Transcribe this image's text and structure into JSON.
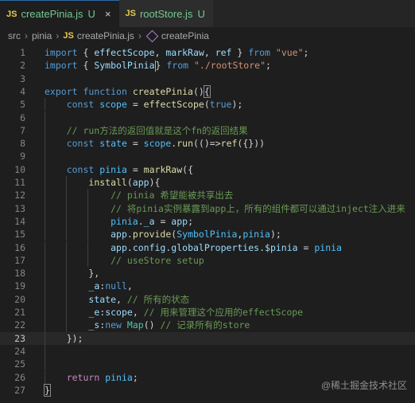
{
  "tabs": [
    {
      "icon": "JS",
      "label": "createPinia.js",
      "status": "U",
      "close": "×"
    },
    {
      "icon": "JS",
      "label": "rootStore.js",
      "status": "U"
    }
  ],
  "breadcrumb": {
    "items": [
      "src",
      "pinia"
    ],
    "file": "createPinia.js",
    "symbol": "createPinia",
    "sep": "›"
  },
  "lines": [
    {
      "n": "1",
      "tokens": [
        [
          "kw",
          "import"
        ],
        [
          "op",
          " { "
        ],
        [
          "var",
          "effectScope"
        ],
        [
          "op",
          ", "
        ],
        [
          "var",
          "markRaw"
        ],
        [
          "op",
          ", "
        ],
        [
          "var",
          "ref"
        ],
        [
          "op",
          " } "
        ],
        [
          "kw",
          "from"
        ],
        [
          "op",
          " "
        ],
        [
          "str",
          "\"vue\""
        ],
        [
          "op",
          ";"
        ]
      ]
    },
    {
      "n": "2",
      "tokens": [
        [
          "kw",
          "import"
        ],
        [
          "op",
          " { "
        ],
        [
          "var",
          "SymbolPinia"
        ],
        [
          "cursor",
          ""
        ],
        [
          "op",
          "} "
        ],
        [
          "kw",
          "from"
        ],
        [
          "op",
          " "
        ],
        [
          "str",
          "\"./rootStore\""
        ],
        [
          "op",
          ";"
        ]
      ]
    },
    {
      "n": "3",
      "tokens": []
    },
    {
      "n": "4",
      "tokens": [
        [
          "kw",
          "export"
        ],
        [
          "op",
          " "
        ],
        [
          "kw",
          "function"
        ],
        [
          "op",
          " "
        ],
        [
          "fn",
          "createPinia"
        ],
        [
          "op",
          "()"
        ],
        [
          "bracket",
          "{"
        ]
      ]
    },
    {
      "n": "5",
      "tokens": [
        [
          "op",
          "    "
        ],
        [
          "kw",
          "const"
        ],
        [
          "op",
          " "
        ],
        [
          "const",
          "scope"
        ],
        [
          "op",
          " = "
        ],
        [
          "fn",
          "effectScope"
        ],
        [
          "op",
          "("
        ],
        [
          "kw",
          "true"
        ],
        [
          "op",
          ");"
        ]
      ]
    },
    {
      "n": "6",
      "tokens": []
    },
    {
      "n": "7",
      "tokens": [
        [
          "op",
          "    "
        ],
        [
          "cmt",
          "// run方法的返回值就是这个fn的返回结果"
        ]
      ]
    },
    {
      "n": "8",
      "tokens": [
        [
          "op",
          "    "
        ],
        [
          "kw",
          "const"
        ],
        [
          "op",
          " "
        ],
        [
          "const",
          "state"
        ],
        [
          "op",
          " = "
        ],
        [
          "const",
          "scope"
        ],
        [
          "op",
          "."
        ],
        [
          "fn",
          "run"
        ],
        [
          "op",
          "(()=>"
        ],
        [
          "fn",
          "ref"
        ],
        [
          "op",
          "({}))"
        ]
      ]
    },
    {
      "n": "9",
      "tokens": []
    },
    {
      "n": "10",
      "tokens": [
        [
          "op",
          "    "
        ],
        [
          "kw",
          "const"
        ],
        [
          "op",
          " "
        ],
        [
          "const",
          "pinia"
        ],
        [
          "op",
          " = "
        ],
        [
          "fn",
          "markRaw"
        ],
        [
          "op",
          "({"
        ]
      ]
    },
    {
      "n": "11",
      "tokens": [
        [
          "op",
          "        "
        ],
        [
          "fn",
          "install"
        ],
        [
          "op",
          "("
        ],
        [
          "var",
          "app"
        ],
        [
          "op",
          "){"
        ]
      ]
    },
    {
      "n": "12",
      "tokens": [
        [
          "op",
          "            "
        ],
        [
          "cmt",
          "// pinia 希望能被共享出去"
        ]
      ]
    },
    {
      "n": "13",
      "tokens": [
        [
          "op",
          "            "
        ],
        [
          "cmt",
          "// 将pinia实例暴露到app上，所有的组件都可以通过inject注入进来"
        ]
      ]
    },
    {
      "n": "14",
      "tokens": [
        [
          "op",
          "            "
        ],
        [
          "const",
          "pinia"
        ],
        [
          "op",
          "."
        ],
        [
          "var",
          "_a"
        ],
        [
          "op",
          " = "
        ],
        [
          "var",
          "app"
        ],
        [
          "op",
          ";"
        ]
      ]
    },
    {
      "n": "15",
      "tokens": [
        [
          "op",
          "            "
        ],
        [
          "var",
          "app"
        ],
        [
          "op",
          "."
        ],
        [
          "fn",
          "provide"
        ],
        [
          "op",
          "("
        ],
        [
          "const",
          "SymbolPinia"
        ],
        [
          "op",
          ","
        ],
        [
          "const",
          "pinia"
        ],
        [
          "op",
          ");"
        ]
      ]
    },
    {
      "n": "16",
      "tokens": [
        [
          "op",
          "            "
        ],
        [
          "var",
          "app"
        ],
        [
          "op",
          "."
        ],
        [
          "var",
          "config"
        ],
        [
          "op",
          "."
        ],
        [
          "var",
          "globalProperties"
        ],
        [
          "op",
          "."
        ],
        [
          "var",
          "$pinia"
        ],
        [
          "op",
          " = "
        ],
        [
          "const",
          "pinia"
        ]
      ]
    },
    {
      "n": "17",
      "tokens": [
        [
          "op",
          "            "
        ],
        [
          "cmt",
          "// useStore setup"
        ]
      ]
    },
    {
      "n": "18",
      "tokens": [
        [
          "op",
          "        },"
        ]
      ]
    },
    {
      "n": "19",
      "tokens": [
        [
          "op",
          "        "
        ],
        [
          "var",
          "_a"
        ],
        [
          "op",
          ":"
        ],
        [
          "kw",
          "null"
        ],
        [
          "op",
          ","
        ]
      ]
    },
    {
      "n": "20",
      "tokens": [
        [
          "op",
          "        "
        ],
        [
          "var",
          "state"
        ],
        [
          "op",
          ", "
        ],
        [
          "cmt",
          "// 所有的状态"
        ]
      ]
    },
    {
      "n": "21",
      "tokens": [
        [
          "op",
          "        "
        ],
        [
          "var",
          "_e"
        ],
        [
          "op",
          ":"
        ],
        [
          "var",
          "scope"
        ],
        [
          "op",
          ", "
        ],
        [
          "cmt",
          "// 用来管理这个应用的effectScope"
        ]
      ]
    },
    {
      "n": "22",
      "tokens": [
        [
          "op",
          "        "
        ],
        [
          "var",
          "_s"
        ],
        [
          "op",
          ":"
        ],
        [
          "kw",
          "new"
        ],
        [
          "op",
          " "
        ],
        [
          "cls",
          "Map"
        ],
        [
          "op",
          "() "
        ],
        [
          "cmt",
          "// 记录所有的store"
        ]
      ]
    },
    {
      "n": "23",
      "tokens": [
        [
          "op",
          "    });"
        ]
      ],
      "current": true
    },
    {
      "n": "24",
      "tokens": []
    },
    {
      "n": "25",
      "tokens": []
    },
    {
      "n": "26",
      "tokens": [
        [
          "op",
          "    "
        ],
        [
          "ctl",
          "return"
        ],
        [
          "op",
          " "
        ],
        [
          "const",
          "pinia"
        ],
        [
          "op",
          ";"
        ]
      ]
    },
    {
      "n": "27",
      "tokens": [
        [
          "bracket",
          "}"
        ]
      ]
    }
  ],
  "watermark": "@稀土掘金技术社区"
}
